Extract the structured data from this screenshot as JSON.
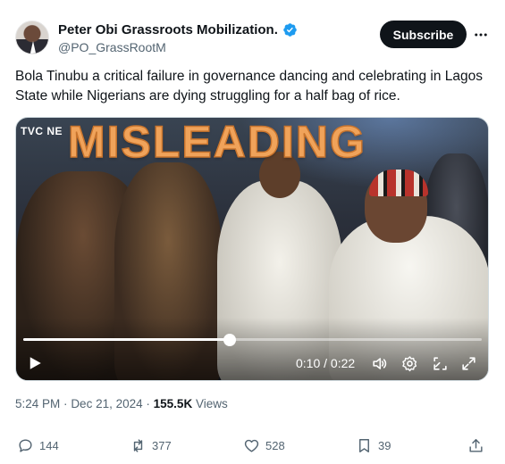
{
  "author": {
    "name": "Peter Obi Grassroots Mobilization.",
    "handle": "@PO_GrassRootM",
    "avatar_icon": "avatar"
  },
  "header": {
    "subscribe_label": "Subscribe",
    "more_icon": "more-icon"
  },
  "tweet": {
    "text": "Bola Tinubu a critical failure in governance dancing and celebrating in Lagos State while Nigerians are dying struggling for a half bag of rice."
  },
  "media": {
    "channel_logo": "TVC NE",
    "stamp": "MISLEADING",
    "progress": 0.45,
    "time_display": "0:10 / 0:22"
  },
  "meta": {
    "time": "5:24 PM",
    "date": "Dec 21, 2024",
    "separator": "·",
    "views_count": "155.5K",
    "views_label": "Views"
  },
  "actions": {
    "replies": "144",
    "reposts": "377",
    "likes": "528",
    "bookmarks": "39"
  },
  "colors": {
    "verified": "#1d9bf0",
    "stamp": "#f0a35a",
    "text_primary": "#0f1419",
    "text_secondary": "#536471"
  }
}
